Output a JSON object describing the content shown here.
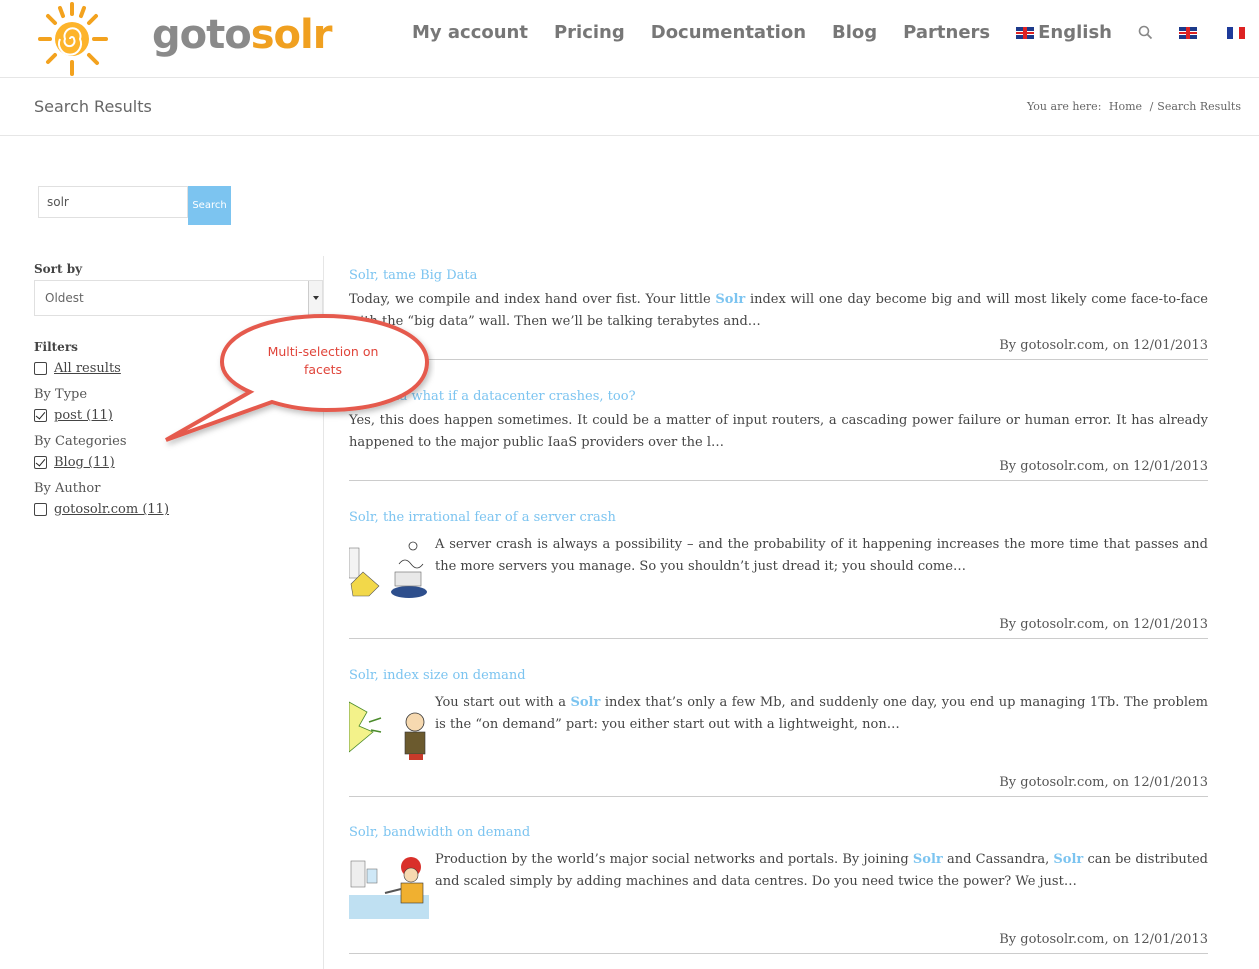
{
  "header": {
    "logo_goto": "goto",
    "logo_solr": "solr",
    "nav": {
      "my_account": "My account",
      "pricing": "Pricing",
      "documentation": "Documentation",
      "blog": "Blog",
      "partners": "Partners",
      "language": "English"
    }
  },
  "titlebar": {
    "title": "Search Results",
    "breadcrumb_prefix": "You are here:",
    "breadcrumb_home": "Home",
    "breadcrumb_sep": "/",
    "breadcrumb_current": "Search Results"
  },
  "search": {
    "value": "solr",
    "button": "Search"
  },
  "sidebar": {
    "sort_label": "Sort by",
    "sort_value": "Oldest",
    "filters_label": "Filters",
    "all_results": "All results",
    "by_type": "By Type",
    "type_post": "post (11)",
    "by_categories": "By Categories",
    "cat_blog": "Blog (11)",
    "by_author": "By Author",
    "author": "gotosolr.com (11)"
  },
  "callout": {
    "line1": "Multi-selection on",
    "line2": "facets"
  },
  "results": [
    {
      "title": "Solr, tame Big Data",
      "excerpt_before": "Today, we compile and index hand over fist. Your little ",
      "highlight": "Solr",
      "excerpt_after": " index will one day become big and will most likely come face-to-face with the “big data” wall. Then we’ll be talking terabytes and…",
      "meta": "By gotosolr.com, on 12/01/2013"
    },
    {
      "title": "Solr, and what if a datacenter crashes, too?",
      "excerpt": "Yes, this does happen sometimes. It could be a matter of input routers, a cascading power failure or human error. It has already happened to the major public IaaS providers over the l…",
      "meta": "By gotosolr.com, on 12/01/2013"
    },
    {
      "title": "Solr, the irrational fear of a server crash",
      "excerpt": "A server crash is always a possibility – and the probability of it happening increases the more time that passes and the more servers you manage. So you shouldn’t just dread it; you should come…",
      "meta": "By gotosolr.com, on 12/01/2013"
    },
    {
      "title": "Solr, index size on demand",
      "excerpt_before": "You start out with a ",
      "highlight": "Solr",
      "excerpt_after": " index that’s only a few Mb, and suddenly one day, you end up managing 1Tb. The problem is the “on demand” part: you either start out with a lightweight, non…",
      "meta": "By gotosolr.com, on 12/01/2013"
    },
    {
      "title": "Solr, bandwidth on demand",
      "excerpt_a": "Production by the world’s major social networks and portals. By joining ",
      "highlight_a": "Solr",
      "excerpt_b": " and Cassandra, ",
      "highlight_b": "Solr",
      "excerpt_c": " can be distributed and scaled simply by adding machines and data centres. Do you need twice the power? We just…",
      "meta": "By gotosolr.com, on 12/01/2013"
    }
  ]
}
